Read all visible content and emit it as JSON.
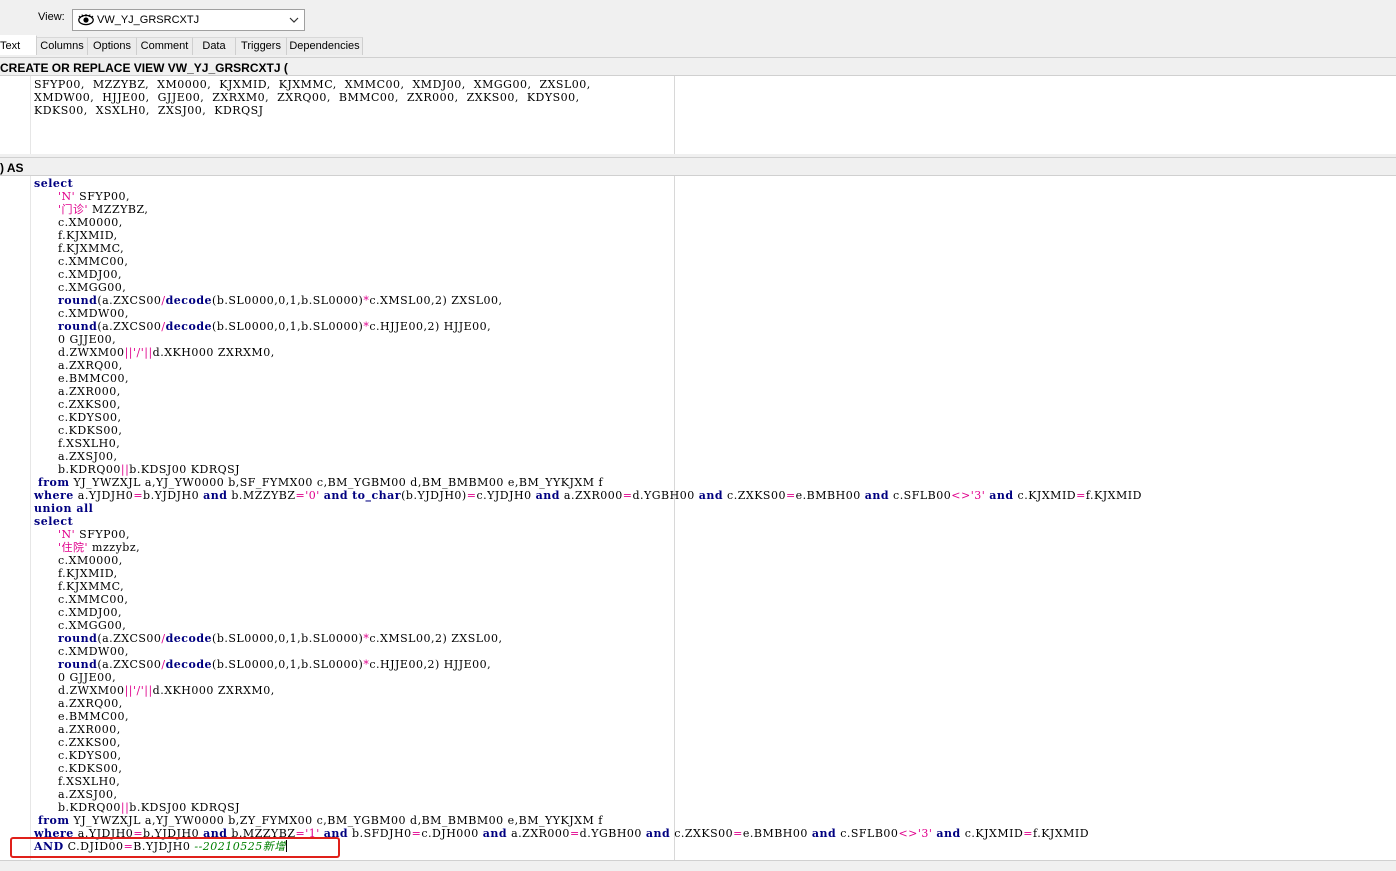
{
  "toolbar": {
    "view_label": "View:",
    "view_value": "VW_YJ_GRSRCXTJ"
  },
  "tabs": [
    {
      "label": "Text",
      "active": true
    },
    {
      "label": "Columns"
    },
    {
      "label": "Options"
    },
    {
      "label": "Comment"
    },
    {
      "label": "Data"
    },
    {
      "label": "Triggers"
    },
    {
      "label": "Dependencies"
    }
  ],
  "header": {
    "create_line": "CREATE OR REPLACE VIEW VW_YJ_GRSRCXTJ (",
    "as_line": ") AS"
  },
  "columns_block": [
    "SFYP00,  MZZYBZ,  XM0000,  KJXMID,  KJXMMC,  XMMC00,  XMDJ00,  XMGG00,  ZXSL00,",
    "XMDW00,  HJJE00,  GJJE00,  ZXRXM0,  ZXRQ00,  BMMC00,  ZXR000,  ZXKS00,  KDYS00,",
    "KDKS00,  XSXLH0,  ZXSJ00,  KDRQSJ"
  ],
  "sql_lines": [
    [
      {
        "t": "select",
        "c": "kw"
      }
    ],
    [
      {
        "t": "      "
      },
      {
        "t": "'N'",
        "c": "str"
      },
      {
        "t": " SFYP00,"
      }
    ],
    [
      {
        "t": "      "
      },
      {
        "t": "'门诊'",
        "c": "str"
      },
      {
        "t": " MZZYBZ,"
      }
    ],
    [
      {
        "t": "      c.XM0000,"
      }
    ],
    [
      {
        "t": "      f.KJXMID,"
      }
    ],
    [
      {
        "t": "      f.KJXMMC,"
      }
    ],
    [
      {
        "t": "      c.XMMC00,"
      }
    ],
    [
      {
        "t": "      c.XMDJ00,"
      }
    ],
    [
      {
        "t": "      c.XMGG00,"
      }
    ],
    [
      {
        "t": "      "
      },
      {
        "t": "round",
        "c": "kw"
      },
      {
        "t": "(a.ZXCS00"
      },
      {
        "t": "/",
        "c": "op"
      },
      {
        "t": "decode",
        "c": "kw"
      },
      {
        "t": "(b.SL0000,0,1,b.SL0000)"
      },
      {
        "t": "*",
        "c": "op"
      },
      {
        "t": "c.XMSL00,2) ZXSL00,"
      }
    ],
    [
      {
        "t": "      c.XMDW00,"
      }
    ],
    [
      {
        "t": "      "
      },
      {
        "t": "round",
        "c": "kw"
      },
      {
        "t": "(a.ZXCS00"
      },
      {
        "t": "/",
        "c": "op"
      },
      {
        "t": "decode",
        "c": "kw"
      },
      {
        "t": "(b.SL0000,0,1,b.SL0000)"
      },
      {
        "t": "*",
        "c": "op"
      },
      {
        "t": "c.HJJE00,2) HJJE00,"
      }
    ],
    [
      {
        "t": "      0 GJJE00,"
      }
    ],
    [
      {
        "t": "      d.ZWXM00"
      },
      {
        "t": "||",
        "c": "op"
      },
      {
        "t": "'/'",
        "c": "str"
      },
      {
        "t": "||",
        "c": "op"
      },
      {
        "t": "d.XKH000 ZXRXM0,"
      }
    ],
    [
      {
        "t": "      a.ZXRQ00,"
      }
    ],
    [
      {
        "t": "      e.BMMC00,"
      }
    ],
    [
      {
        "t": "      a.ZXR000,"
      }
    ],
    [
      {
        "t": "      c.ZXKS00,"
      }
    ],
    [
      {
        "t": "      c.KDYS00,"
      }
    ],
    [
      {
        "t": "      c.KDKS00,"
      }
    ],
    [
      {
        "t": "      f.XSXLH0,"
      }
    ],
    [
      {
        "t": "      a.ZXSJ00,"
      }
    ],
    [
      {
        "t": "      b.KDRQ00"
      },
      {
        "t": "||",
        "c": "op"
      },
      {
        "t": "b.KDSJ00 KDRQSJ"
      }
    ],
    [
      {
        "t": " "
      },
      {
        "t": "from",
        "c": "kw"
      },
      {
        "t": " YJ_YWZXJL a,YJ_YW0000 b,SF_FYMX00 c,BM_YGBM00 d,BM_BMBM00 e,BM_YYKJXM f"
      }
    ],
    [
      {
        "t": "where",
        "c": "kw"
      },
      {
        "t": " a.YJDJH0"
      },
      {
        "t": "=",
        "c": "op"
      },
      {
        "t": "b.YJDJH0 "
      },
      {
        "t": "and",
        "c": "kw"
      },
      {
        "t": " b.MZZYBZ"
      },
      {
        "t": "=",
        "c": "op"
      },
      {
        "t": "'0'",
        "c": "str"
      },
      {
        "t": " "
      },
      {
        "t": "and",
        "c": "kw"
      },
      {
        "t": " "
      },
      {
        "t": "to_char",
        "c": "kw"
      },
      {
        "t": "(b.YJDJH0)"
      },
      {
        "t": "=",
        "c": "op"
      },
      {
        "t": "c.YJDJH0 "
      },
      {
        "t": "and",
        "c": "kw"
      },
      {
        "t": " a.ZXR000"
      },
      {
        "t": "=",
        "c": "op"
      },
      {
        "t": "d.YGBH00 "
      },
      {
        "t": "and",
        "c": "kw"
      },
      {
        "t": " c.ZXKS00"
      },
      {
        "t": "=",
        "c": "op"
      },
      {
        "t": "e.BMBH00 "
      },
      {
        "t": "and",
        "c": "kw"
      },
      {
        "t": " c.SFLB00"
      },
      {
        "t": "<>",
        "c": "op"
      },
      {
        "t": "'3'",
        "c": "str"
      },
      {
        "t": " "
      },
      {
        "t": "and",
        "c": "kw"
      },
      {
        "t": " c.KJXMID"
      },
      {
        "t": "=",
        "c": "op"
      },
      {
        "t": "f.KJXMID"
      }
    ],
    [
      {
        "t": "union all",
        "c": "kw"
      }
    ],
    [
      {
        "t": "select",
        "c": "kw"
      }
    ],
    [
      {
        "t": "      "
      },
      {
        "t": "'N'",
        "c": "str"
      },
      {
        "t": " SFYP00,"
      }
    ],
    [
      {
        "t": "      "
      },
      {
        "t": "'住院'",
        "c": "str"
      },
      {
        "t": " mzzybz,"
      }
    ],
    [
      {
        "t": "      c.XM0000,"
      }
    ],
    [
      {
        "t": "      f.KJXMID,"
      }
    ],
    [
      {
        "t": "      f.KJXMMC,"
      }
    ],
    [
      {
        "t": "      c.XMMC00,"
      }
    ],
    [
      {
        "t": "      c.XMDJ00,"
      }
    ],
    [
      {
        "t": "      c.XMGG00,"
      }
    ],
    [
      {
        "t": "      "
      },
      {
        "t": "round",
        "c": "kw"
      },
      {
        "t": "(a.ZXCS00"
      },
      {
        "t": "/",
        "c": "op"
      },
      {
        "t": "decode",
        "c": "kw"
      },
      {
        "t": "(b.SL0000,0,1,b.SL0000)"
      },
      {
        "t": "*",
        "c": "op"
      },
      {
        "t": "c.XMSL00,2) ZXSL00,"
      }
    ],
    [
      {
        "t": "      c.XMDW00,"
      }
    ],
    [
      {
        "t": "      "
      },
      {
        "t": "round",
        "c": "kw"
      },
      {
        "t": "(a.ZXCS00"
      },
      {
        "t": "/",
        "c": "op"
      },
      {
        "t": "decode",
        "c": "kw"
      },
      {
        "t": "(b.SL0000,0,1,b.SL0000)"
      },
      {
        "t": "*",
        "c": "op"
      },
      {
        "t": "c.HJJE00,2) HJJE00,"
      }
    ],
    [
      {
        "t": "      0 GJJE00,"
      }
    ],
    [
      {
        "t": "      d.ZWXM00"
      },
      {
        "t": "||",
        "c": "op"
      },
      {
        "t": "'/'",
        "c": "str"
      },
      {
        "t": "||",
        "c": "op"
      },
      {
        "t": "d.XKH000 ZXRXM0,"
      }
    ],
    [
      {
        "t": "      a.ZXRQ00,"
      }
    ],
    [
      {
        "t": "      e.BMMC00,"
      }
    ],
    [
      {
        "t": "      a.ZXR000,"
      }
    ],
    [
      {
        "t": "      c.ZXKS00,"
      }
    ],
    [
      {
        "t": "      c.KDYS00,"
      }
    ],
    [
      {
        "t": "      c.KDKS00,"
      }
    ],
    [
      {
        "t": "      f.XSXLH0,"
      }
    ],
    [
      {
        "t": "      a.ZXSJ00,"
      }
    ],
    [
      {
        "t": "      b.KDRQ00"
      },
      {
        "t": "||",
        "c": "op"
      },
      {
        "t": "b.KDSJ00 KDRQSJ"
      }
    ],
    [
      {
        "t": " "
      },
      {
        "t": "from",
        "c": "kw"
      },
      {
        "t": " YJ_YWZXJL a,YJ_YW0000 b,ZY_FYMX00 c,BM_YGBM00 d,BM_BMBM00 e,BM_YYKJXM f"
      }
    ],
    [
      {
        "t": "where",
        "c": "kw"
      },
      {
        "t": " a.YJDJH0"
      },
      {
        "t": "=",
        "c": "op"
      },
      {
        "t": "b.YJDJH0 "
      },
      {
        "t": "and",
        "c": "kw"
      },
      {
        "t": " b.MZZYBZ"
      },
      {
        "t": "=",
        "c": "op"
      },
      {
        "t": "'1'",
        "c": "str"
      },
      {
        "t": " "
      },
      {
        "t": "and",
        "c": "kw"
      },
      {
        "t": " b.SFDJH0"
      },
      {
        "t": "=",
        "c": "op"
      },
      {
        "t": "c.DJH000 "
      },
      {
        "t": "and",
        "c": "kw"
      },
      {
        "t": " a.ZXR000"
      },
      {
        "t": "=",
        "c": "op"
      },
      {
        "t": "d.YGBH00 "
      },
      {
        "t": "and",
        "c": "kw"
      },
      {
        "t": " c.ZXKS00"
      },
      {
        "t": "=",
        "c": "op"
      },
      {
        "t": "e.BMBH00 "
      },
      {
        "t": "and",
        "c": "kw"
      },
      {
        "t": " c.SFLB00"
      },
      {
        "t": "<>",
        "c": "op"
      },
      {
        "t": "'3'",
        "c": "str"
      },
      {
        "t": " "
      },
      {
        "t": "and",
        "c": "kw"
      },
      {
        "t": " c.KJXMID"
      },
      {
        "t": "=",
        "c": "op"
      },
      {
        "t": "f.KJXMID"
      }
    ],
    [
      {
        "t": "AND",
        "c": "kw"
      },
      {
        "t": " C.DJID00"
      },
      {
        "t": "=",
        "c": "op"
      },
      {
        "t": "B.YJDJH0 "
      },
      {
        "t": "--20210525新增",
        "c": "cmt"
      },
      {
        "t": "",
        "caret": true
      }
    ]
  ],
  "colors": {
    "keyword": "#000080",
    "string": "#e0008c",
    "comment": "#008000",
    "highlight": "#e0201a"
  }
}
